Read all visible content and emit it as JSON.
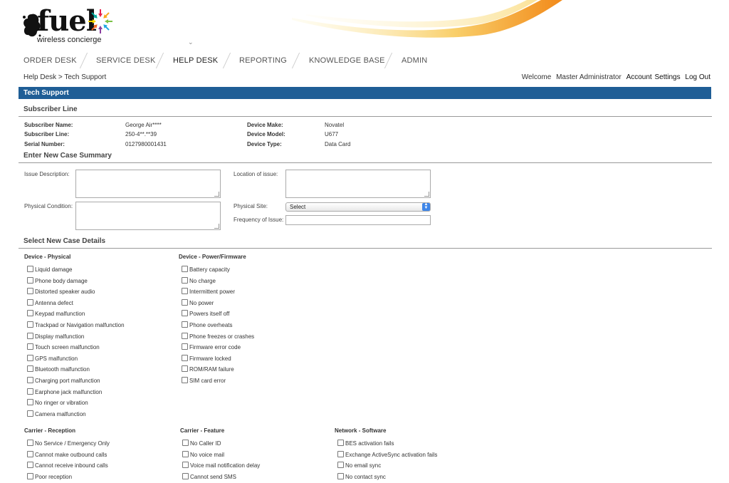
{
  "brand": {
    "name": "fuel",
    "tagline": "wireless concierge",
    "arrow_colors": [
      "#e8204b",
      "#f7a81b",
      "#7ac143",
      "#1fa7e1",
      "#8a3ea0",
      "#f26522",
      "#fcd700",
      "#00a99d"
    ]
  },
  "nav": [
    {
      "label": "ORDER DESK",
      "active": false
    },
    {
      "label": "SERVICE DESK",
      "active": false
    },
    {
      "label": "HELP DESK",
      "active": true
    },
    {
      "label": "REPORTING",
      "active": false
    },
    {
      "label": "KNOWLEDGE BASE",
      "active": false
    },
    {
      "label": "ADMIN",
      "active": false
    }
  ],
  "breadcrumb": "Help Desk > Tech Support",
  "header": {
    "welcome": "Welcome",
    "user": "Master Administrator",
    "account": "Account",
    "settings": "Settings",
    "logout": "Log Out"
  },
  "page_title": "Tech Support",
  "subscriber": {
    "title": "Subscriber Line",
    "left": [
      {
        "label": "Subscriber Name:",
        "value": "George Air****"
      },
      {
        "label": "Subscriber Line:",
        "value": "250-4**.**39"
      },
      {
        "label": "Serial Number:",
        "value": "0127980001431"
      }
    ],
    "right": [
      {
        "label": "Device Make:",
        "value": "Novatel"
      },
      {
        "label": "Device Model:",
        "value": "U677"
      },
      {
        "label": "Device Type:",
        "value": "Data Card"
      }
    ]
  },
  "case_summary": {
    "title": "Enter New Case Summary",
    "issue_description": "Issue Description:",
    "physical_condition": "Physical Condition:",
    "location": "Location of issue:",
    "physical_site": "Physical Site:",
    "physical_site_value": "Select",
    "frequency": "Frequency of Issue:"
  },
  "case_details": {
    "title": "Select New Case Details",
    "groups": [
      {
        "title": "Device - Physical",
        "items": [
          "Liquid damage",
          "Phone body damage",
          "Distorted speaker audio",
          "Antenna defect",
          "Keypad malfunction",
          "Trackpad or Navigation malfunction",
          "Display malfunction",
          "Touch screen malfunction",
          "GPS malfunction",
          "Bluetooth malfunction",
          "Charging port malfunction",
          "Earphone jack malfunction",
          "No ringer or vibration",
          "Camera malfunction"
        ]
      },
      {
        "title": "Device - Power/Firmware",
        "items": [
          "Battery capacity",
          "No charge",
          "Intermittent power",
          "No power",
          "Powers itself off",
          "Phone overheats",
          "Phone freezes or crashes",
          "Firmware error code",
          "Firmware locked",
          "ROM/RAM failure",
          "SIM card error"
        ]
      },
      {
        "title": "Carrier - Reception",
        "items": [
          "No Service / Emergency Only",
          "Cannot make outbound calls",
          "Cannot receive inbound calls",
          "Poor reception"
        ]
      },
      {
        "title": "Carrier - Feature",
        "items": [
          "No Caller ID",
          "No voice mail",
          "Voice mail notification delay",
          "Cannot send SMS"
        ]
      },
      {
        "title": "Network - Software",
        "items": [
          "BES activation fails",
          "Exchange ActiveSync activation fails",
          "No email sync",
          "No contact sync"
        ]
      }
    ]
  }
}
